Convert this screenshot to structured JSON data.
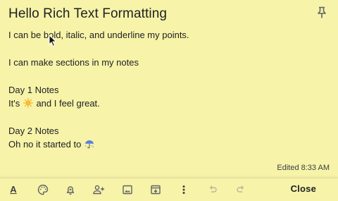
{
  "note": {
    "title": "Hello Rich Text Formatting",
    "lines": [
      "I can be bold, italic, and underline my points.",
      "",
      "I can make sections in my notes",
      "",
      "Day 1 Notes",
      {
        "before": "It's ",
        "emoji": "sun-emoji",
        "after": " and I feel great."
      },
      "",
      "Day 2 Notes",
      {
        "before": "Oh no it started to ",
        "emoji": "umbrella-emoji",
        "after": ""
      }
    ],
    "line_1": "I can be bold, italic, and underline my points.",
    "line_3": "I can make sections in my notes",
    "line_5": "Day 1 Notes",
    "line_6_before": "It's ",
    "line_6_after": " and I feel great.",
    "line_8": "Day 2 Notes",
    "line_9_before": "Oh no it started to ",
    "edited": "Edited 8:33 AM"
  },
  "toolbar": {
    "format_label": "A",
    "close_label": "Close",
    "icons": [
      "formatting-options-icon",
      "background-options-icon",
      "remind-me-icon",
      "collaborator-icon",
      "add-image-icon",
      "archive-icon",
      "more-icon",
      "undo-icon",
      "redo-icon"
    ]
  },
  "colors": {
    "background": "#f7f3a8",
    "text": "#202124",
    "icon": "#5f6368",
    "disabled_icon": "#b9b79a"
  }
}
